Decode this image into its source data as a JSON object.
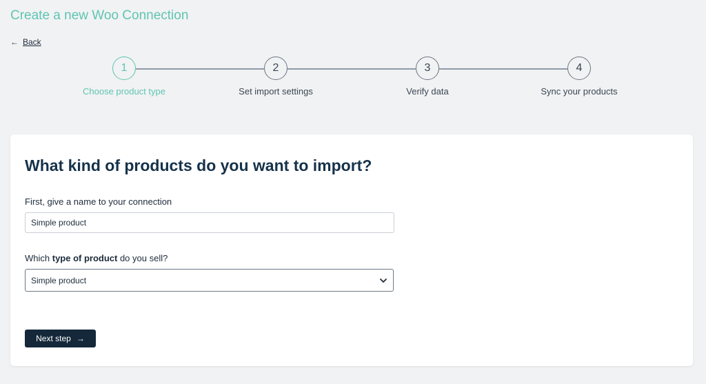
{
  "header": {
    "title": "Create a new Woo Connection",
    "back_label": "Back",
    "back_icon": "arrow-left-icon"
  },
  "stepper": {
    "active_step": 1,
    "steps": [
      {
        "number": "1",
        "label": "Choose product type"
      },
      {
        "number": "2",
        "label": "Set import settings"
      },
      {
        "number": "3",
        "label": "Verify data"
      },
      {
        "number": "4",
        "label": "Sync your products"
      }
    ]
  },
  "card": {
    "heading": "What kind of products do you want to import?",
    "name_field": {
      "label": "First, give a name to your connection",
      "value": "Simple product"
    },
    "type_field": {
      "label_prefix": "Which ",
      "label_bold": "type of product",
      "label_suffix": " do you sell?",
      "selected_value": "Simple product",
      "icon": "chevron-down-icon"
    },
    "next_button": {
      "label": "Next step",
      "icon": "arrow-right-icon"
    }
  },
  "colors": {
    "accent": "#5fc4b3",
    "primary_dark": "#14283a",
    "background": "#f1f2f3"
  }
}
